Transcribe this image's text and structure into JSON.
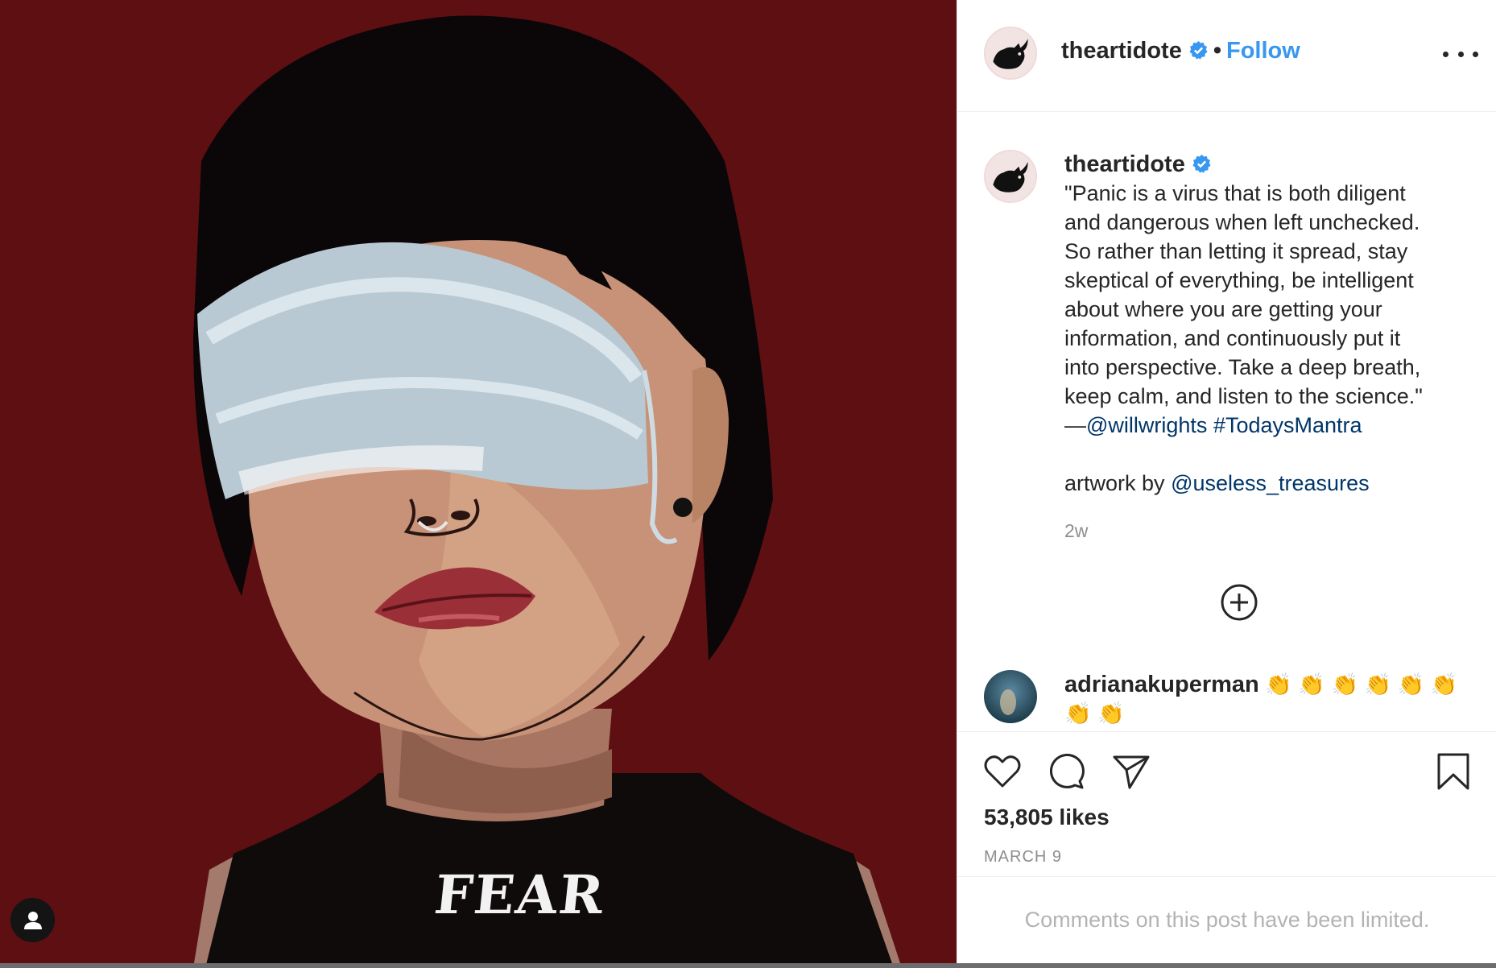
{
  "post": {
    "author": {
      "username": "theartidote",
      "verified": true,
      "follow_label": "Follow",
      "separator": "•"
    },
    "caption": {
      "username": "theartidote",
      "lines": [
        "\"Panic is a virus that is both diligent",
        "and dangerous when left unchecked.",
        "So rather than letting it spread, stay",
        "skeptical of everything, be intelligent",
        "about where you are getting your",
        "information, and continuously put it",
        "into perspective. Take a deep breath,",
        "keep calm, and listen to the science.\""
      ],
      "dash": "—",
      "mention": "@willwrights",
      "hashtag": "#TodaysMantra",
      "artwork_prefix": "artwork by",
      "artwork_mention": "@useless_treasures",
      "time": "2w"
    },
    "comment": {
      "username": "adrianakuperman",
      "text": "👏 👏 👏 👏 👏 👏 👏 👏"
    },
    "likes": "53,805 likes",
    "date": "MARCH 9",
    "comments_limited": "Comments on this post have been limited.",
    "artwork_shirt_text": "FEAR"
  },
  "icons": {
    "more": "more-options-icon",
    "like": "heart-icon",
    "comment": "comment-bubble-icon",
    "share": "paper-plane-icon",
    "save": "bookmark-icon",
    "load_more": "plus-circle-icon",
    "user_tag": "person-icon",
    "verified": "verified-badge-icon"
  },
  "colors": {
    "background_art": "#5e0f12",
    "link_blue": "#3897f0",
    "mention": "#003569",
    "verified_blue": "#3897f0",
    "muted": "#8e8e8e"
  }
}
